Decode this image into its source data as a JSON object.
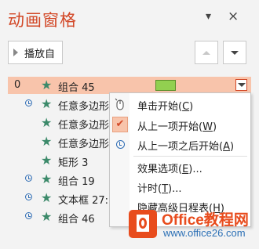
{
  "pane": {
    "title": "动画窗格",
    "dropdown_glyph": "▾",
    "close_glyph": "×"
  },
  "toolbar": {
    "play_label": "播放自",
    "up_icon": "triangle-up-icon",
    "down_icon": "triangle-down-icon"
  },
  "animations": [
    {
      "num": "0",
      "label": "组合 45",
      "selected": true,
      "trigger": "with-previous"
    },
    {
      "num": "",
      "label": "任意多边形",
      "trigger": "after-previous"
    },
    {
      "num": "",
      "label": "任意多边形",
      "trigger": "with-previous"
    },
    {
      "num": "",
      "label": "任意多边形",
      "trigger": "with-previous"
    },
    {
      "num": "",
      "label": "矩形 3",
      "trigger": "with-previous"
    },
    {
      "num": "",
      "label": "组合 19",
      "trigger": "after-previous"
    },
    {
      "num": "",
      "label": "文本框 27:",
      "trigger": "after-previous"
    },
    {
      "num": "",
      "label": "组合 46",
      "trigger": "after-previous"
    }
  ],
  "colors": {
    "accent": "#d24726",
    "selected_row": "#f8c4ab",
    "star": "#3c8a6a",
    "timing_bar": "#92d050",
    "clock": "#2f6db5"
  },
  "context_menu": {
    "items": [
      {
        "text": "单击开始(",
        "key": "C",
        "end": ")",
        "icon": "mouse-click-icon"
      },
      {
        "text": "从上一项开始(",
        "key": "W",
        "end": ")",
        "icon": "check-icon",
        "checked": true
      },
      {
        "text": "从上一项之后开始(",
        "key": "A",
        "end": ")",
        "icon": "clock-icon"
      },
      {
        "text": "效果选项(",
        "key": "E",
        "end": ")..."
      },
      {
        "text": "计时(",
        "key": "T",
        "end": ")..."
      },
      {
        "text": "隐藏高级日程表(",
        "key": "H",
        "end": ")"
      }
    ]
  },
  "watermark": {
    "name": "Office教程网",
    "url": "www.office26.com"
  }
}
